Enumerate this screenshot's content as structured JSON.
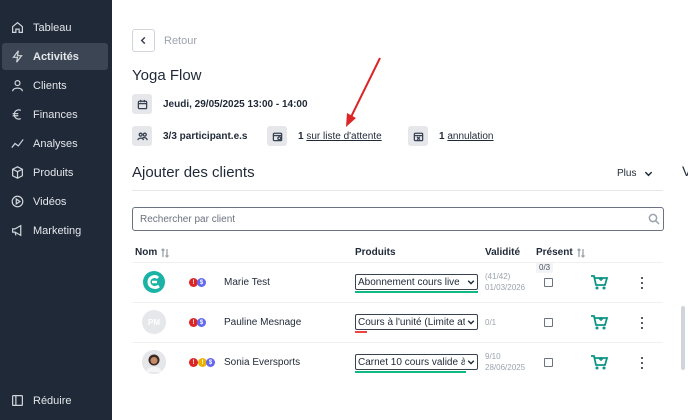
{
  "sidebar": {
    "items": [
      {
        "label": "Tableau",
        "icon": "home-icon"
      },
      {
        "label": "Activités",
        "icon": "bolt-icon"
      },
      {
        "label": "Clients",
        "icon": "user-icon"
      },
      {
        "label": "Finances",
        "icon": "euro-icon"
      },
      {
        "label": "Analyses",
        "icon": "chart-line-icon"
      },
      {
        "label": "Produits",
        "icon": "box-icon"
      },
      {
        "label": "Vidéos",
        "icon": "play-circle-icon"
      },
      {
        "label": "Marketing",
        "icon": "megaphone-icon"
      }
    ],
    "active": "Activités",
    "collapse_label": "Réduire"
  },
  "header": {
    "back_label": "Retour",
    "title": "Yoga Flow"
  },
  "session": {
    "datetime": "Jeudi, 29/05/2025 13:00 - 14:00",
    "participants": "3/3 participant.e.s",
    "waitlist_count": "1",
    "waitlist_label": "sur liste d'attente",
    "cancel_count": "1",
    "cancel_label": "annulation"
  },
  "clients_section": {
    "title": "Ajouter des clients",
    "more_label": "Plus",
    "search_placeholder": "Rechercher par client"
  },
  "table": {
    "headers": {
      "name": "Nom",
      "products": "Produits",
      "validity": "Validité",
      "present": "Présent"
    },
    "present_count": "0/3",
    "rows": [
      {
        "avatar": "logo",
        "initials": "",
        "name": "Marie Test",
        "product": "Abonnement cours live",
        "usage": "(41/42)",
        "date": "01/03/2026",
        "bar_color": "#10b981"
      },
      {
        "avatar": "initials",
        "initials": "PM",
        "name": "Pauline Mesnage",
        "product": "Cours à l'unité (Limite at",
        "usage": "0/1",
        "date": "",
        "bar_color": "#ef4444"
      },
      {
        "avatar": "photo",
        "initials": "",
        "name": "Sonia Eversports",
        "product": "Carnet 10 cours valide à",
        "usage": "9/10",
        "date": "28/06/2025",
        "bar_color": "#10b981"
      }
    ]
  },
  "colors": {
    "sidebar_bg": "#1f2937",
    "accent_teal": "#10b981",
    "cart_green": "#0d9488",
    "warning_red": "#ef4444"
  },
  "edge_text": "V"
}
